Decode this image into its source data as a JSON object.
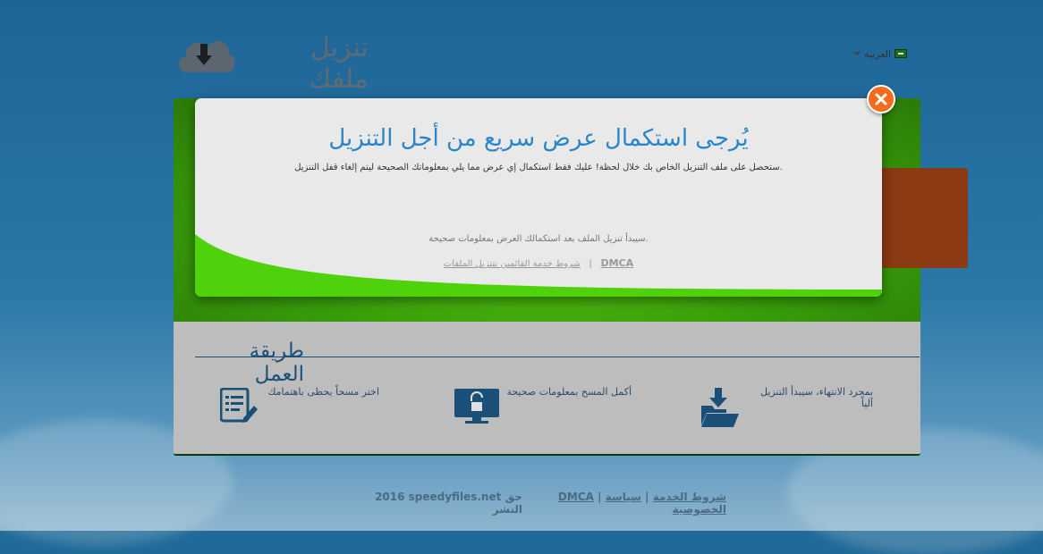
{
  "header": {
    "site_title": "تنزيل ملفك",
    "language": "العربية"
  },
  "modal": {
    "title": "يُرجى استكمال عرض سريع من أجل التنزيل",
    "description": ".ستحصل على ملف التنزيل الخاص بك خلال لحظة! عليك فقط استكمال إي عرض مما يلي بمعلوماتك الصحيحة ليتم إلغاء قفل التنزيل",
    "note": ".سيبدأ تنزيل الملف بعد استكمالك العرض بمعلومات صحيحة",
    "dmca": "DMCA",
    "separator": "|",
    "terms": "شروط خدمة القائمين بتنزيل الملفات"
  },
  "how_it_works": {
    "title": "طريقة العمل",
    "steps": [
      {
        "text": "اختر مسحاً يحظى باهتمامك",
        "icon": "survey-edit-icon"
      },
      {
        "text": "أكمل المسح بمعلومات صحيحة",
        "icon": "unlock-monitor-icon"
      },
      {
        "text": "بمجرد الانتهاء، سيبدأ التنزيل آلياً",
        "icon": "download-folder-icon"
      }
    ]
  },
  "footer": {
    "copyright": "2016 speedyfiles.net حق النشر",
    "privacy": "سياسة الخصوصية",
    "terms": "شروط الخدمة",
    "dmca": "DMCA",
    "separator": "|"
  },
  "colors": {
    "background": "#1f6a98",
    "green": "#4fd20c",
    "title_blue": "#2b86c7",
    "close_orange": "#f36b1c",
    "dark_blue": "#1a5078"
  }
}
